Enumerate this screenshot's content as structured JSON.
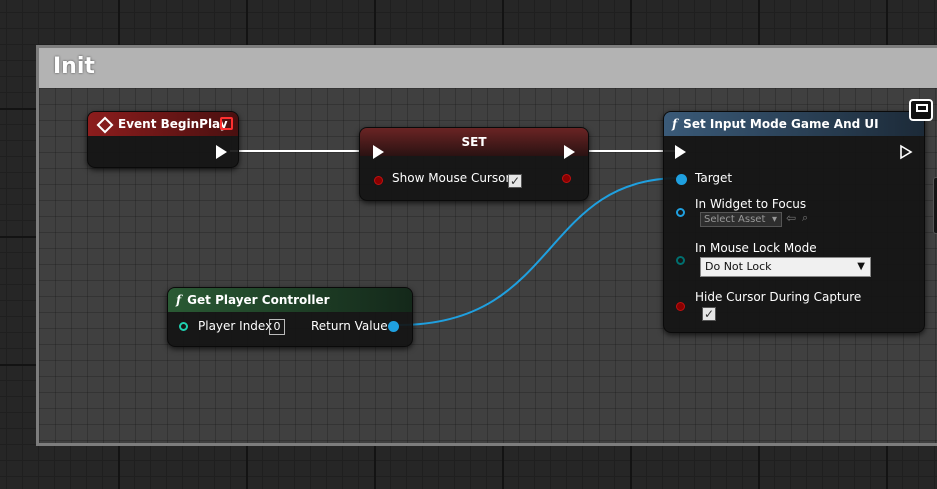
{
  "comment": {
    "title": "Init"
  },
  "event_node": {
    "title": "Event BeginPlay",
    "header_color": "#8c1d1d"
  },
  "set_node": {
    "title": "SET",
    "pin_label": "Show Mouse Cursor",
    "checked": true,
    "header_color": "#7a2a2a"
  },
  "get_controller_node": {
    "title": "Get Player Controller",
    "header_color": "#1e4a2a",
    "input_label": "Player Index",
    "input_value": "0",
    "output_label": "Return Value"
  },
  "set_input_node": {
    "title": "Set Input Mode Game And UI",
    "header_color": "#3a5a78",
    "pins": {
      "target": "Target",
      "widget_focus": "In Widget to Focus",
      "widget_placeholder": "Select Asset",
      "lock_mode": "In Mouse Lock Mode",
      "lock_value": "Do Not Lock",
      "hide_cursor": "Hide Cursor During Capture"
    },
    "hide_cursor_checked": true
  },
  "colors": {
    "exec_wire": "#ffffff",
    "object_wire": "#1fa0e0",
    "bool_pin": "#8a0000",
    "enum_pin": "#006060"
  }
}
